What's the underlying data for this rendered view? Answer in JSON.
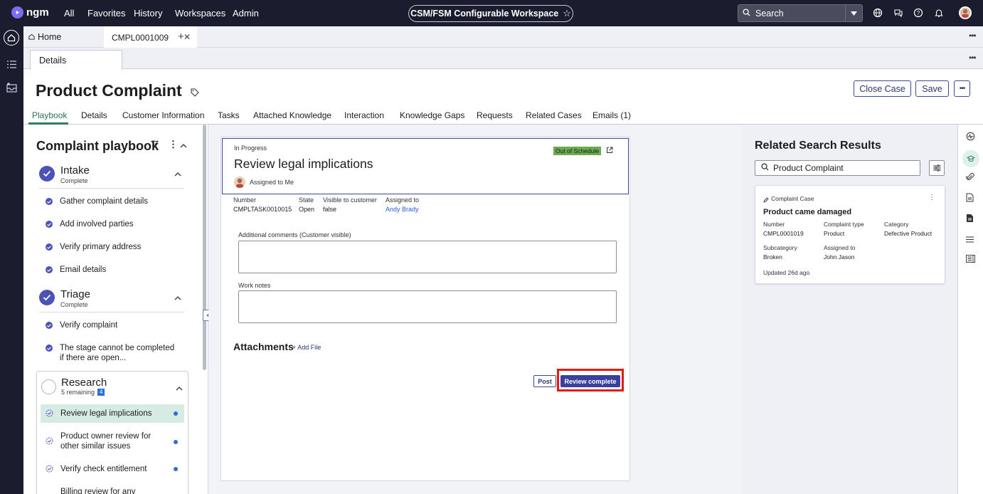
{
  "topnav": {
    "logo_text": "ngm",
    "items": [
      "All",
      "Favorites",
      "History",
      "Workspaces",
      "Admin"
    ],
    "workspace": "CSM/FSM Configurable Workspace",
    "search_label": "Search"
  },
  "tabs": {
    "home": "Home",
    "record": "CMPL0001009"
  },
  "subtab": "Details",
  "header": {
    "title": "Product Complaint",
    "close_case": "Close Case",
    "save": "Save"
  },
  "form_tabs": [
    "Playbook",
    "Details",
    "Customer Information",
    "Tasks",
    "Attached Knowledge",
    "Interaction",
    "Knowledge Gaps",
    "Requests",
    "Related Cases",
    "Emails (1)"
  ],
  "playbook": {
    "title": "Complaint playbook",
    "stages": [
      {
        "title": "Intake",
        "subtitle": "Complete",
        "tasks": [
          "Gather complaint details",
          "Add involved parties",
          "Verify primary address",
          "Email details"
        ]
      },
      {
        "title": "Triage",
        "subtitle": "Complete",
        "tasks": [
          "Verify complaint",
          "The stage cannot be completed if there are open..."
        ]
      },
      {
        "title": "Research",
        "subtitle": "5 remaining",
        "badge": "4",
        "tasks": [
          "Review legal implications",
          "Product owner review for other similar issues",
          "Verify check entitlement",
          "Billing review for any"
        ]
      }
    ]
  },
  "task_card": {
    "status": "In Progress",
    "schedule_badge": "Out of Schedule",
    "title": "Review legal implications",
    "assigned": "Assigned to Me",
    "fields": [
      {
        "label": "Number",
        "value": "CMPLTASK0010015"
      },
      {
        "label": "State",
        "value": "Open"
      },
      {
        "label": "Visible to customer",
        "value": "false"
      },
      {
        "label": "Assigned to",
        "value": "Andy Brady"
      }
    ],
    "comments_label": "Additional comments (Customer visible)",
    "comments_value": "",
    "worknotes_label": "Work notes",
    "worknotes_value": "",
    "attachments_label": "Attachments",
    "add_file": "+ Add File",
    "post": "Post",
    "review_complete": "Review complete"
  },
  "related": {
    "title": "Related Search Results",
    "search_value": "Product Complaint",
    "card": {
      "type": "Complaint Case",
      "title": "Product came damaged",
      "fields": [
        {
          "label": "Number",
          "value": "CMPL0001019"
        },
        {
          "label": "Complaint type",
          "value": "Product"
        },
        {
          "label": "Category",
          "value": "Defective Product"
        },
        {
          "label": "Subcategory",
          "value": "Broken"
        },
        {
          "label": "Assigned to",
          "value": "John Jason"
        }
      ],
      "updated": "Updated 26d ago"
    }
  },
  "colors": {
    "nav_bg": "#1b1d2e",
    "accent": "#4b52b8",
    "active_tab": "#2e7d62",
    "highlight_box": "#e8190f",
    "schedule_badge": "#6aab4f"
  }
}
